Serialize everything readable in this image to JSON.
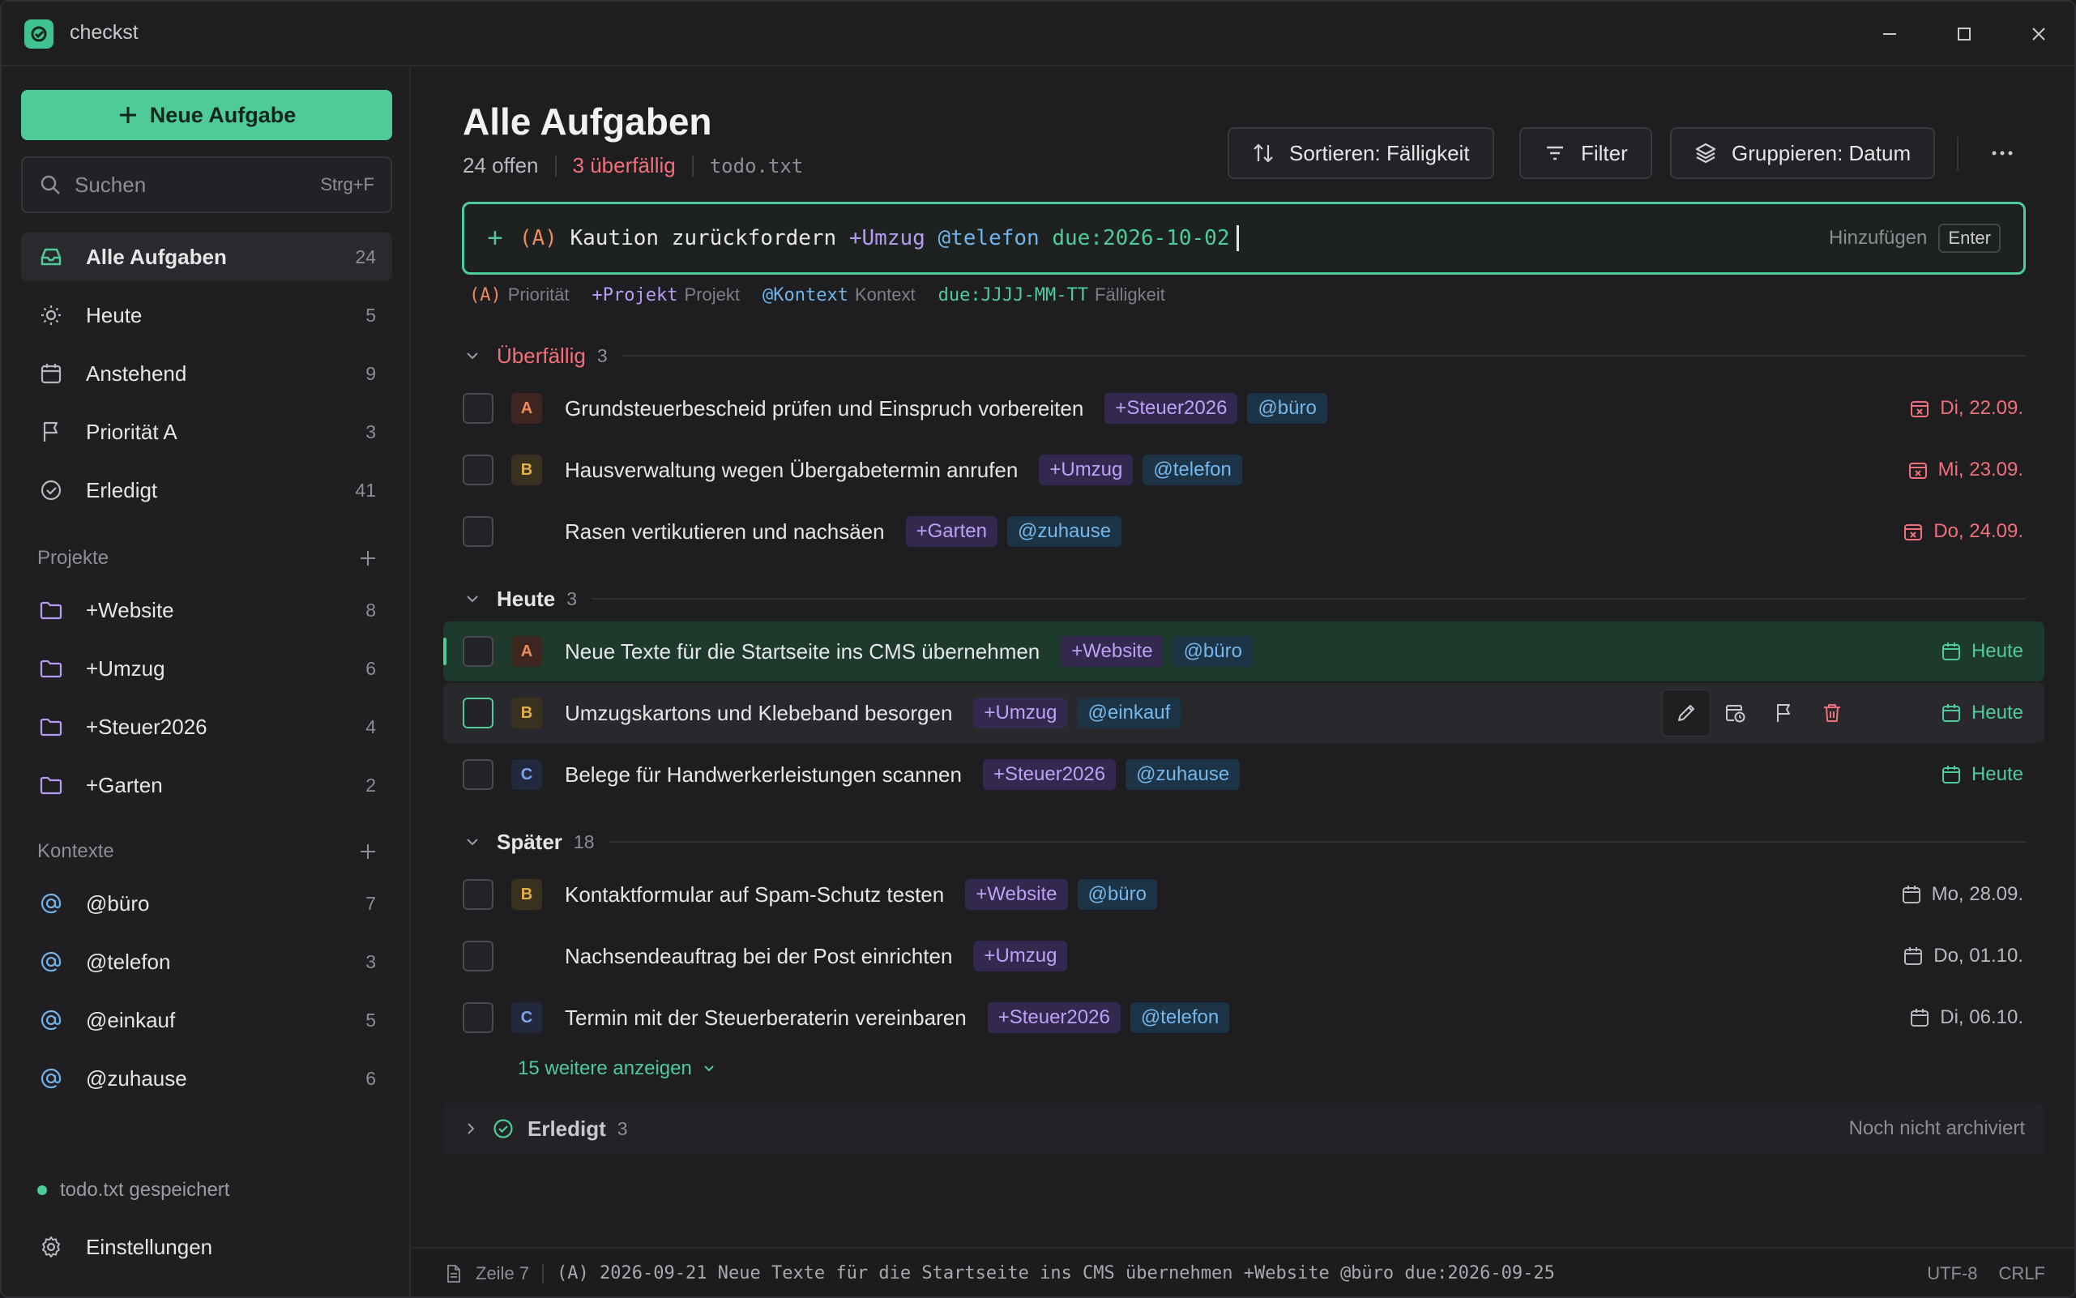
{
  "app": {
    "title": "checkst"
  },
  "sidebar": {
    "new_task_label": "Neue Aufgabe",
    "search_placeholder": "Suchen",
    "search_shortcut": "Strg+F",
    "views": [
      {
        "label": "Alle Aufgaben",
        "count": "24",
        "icon": "inbox-icon",
        "active": true
      },
      {
        "label": "Heute",
        "count": "5",
        "icon": "sun-icon"
      },
      {
        "label": "Anstehend",
        "count": "9",
        "icon": "calendar-icon"
      },
      {
        "label": "Priorität A",
        "count": "3",
        "icon": "flag-icon"
      },
      {
        "label": "Erledigt",
        "count": "41",
        "icon": "check-circle-icon"
      }
    ],
    "projects_heading": "Projekte",
    "projects": [
      {
        "label": "+Website",
        "count": "8"
      },
      {
        "label": "+Umzug",
        "count": "6"
      },
      {
        "label": "+Steuer2026",
        "count": "4"
      },
      {
        "label": "+Garten",
        "count": "2"
      }
    ],
    "contexts_heading": "Kontexte",
    "contexts": [
      {
        "label": "@büro",
        "count": "7"
      },
      {
        "label": "@telefon",
        "count": "3"
      },
      {
        "label": "@einkauf",
        "count": "5"
      },
      {
        "label": "@zuhause",
        "count": "6"
      }
    ],
    "saved_status": "todo.txt gespeichert",
    "settings_label": "Einstellungen"
  },
  "header": {
    "title": "Alle Aufgaben",
    "open_count": "24 offen",
    "overdue_count": "3 überfällig",
    "file": "todo.txt",
    "sort_label": "Sortieren: Fälligkeit",
    "filter_label": "Filter",
    "group_label": "Gruppieren: Datum"
  },
  "quickadd": {
    "prio": "(A)",
    "text": "Kaution zurückfordern",
    "project": "+Umzug",
    "context": "@telefon",
    "due": "due:2026-10-02",
    "hint": "Hinzufügen",
    "key": "Enter"
  },
  "legend": [
    {
      "key": "(A)",
      "desc": "Priorität",
      "kind": "prio"
    },
    {
      "key": "+Projekt",
      "desc": "Projekt",
      "kind": "proj"
    },
    {
      "key": "@Kontext",
      "desc": "Kontext",
      "kind": "ctx"
    },
    {
      "key": "due:JJJJ-MM-TT",
      "desc": "Fälligkeit",
      "kind": "due"
    }
  ],
  "groups": {
    "overdue": {
      "name": "Überfällig",
      "count": "3"
    },
    "today": {
      "name": "Heute",
      "count": "3"
    },
    "later": {
      "name": "Später",
      "count": "18"
    },
    "done": {
      "name": "Erledigt",
      "count": "3",
      "note": "Noch nicht archiviert"
    }
  },
  "tasks": [
    {
      "prio": "A",
      "text": "Grundsteuerbescheid prüfen und Einspruch vorbereiten",
      "project": "+Steuer2026",
      "context": "@büro",
      "due": "Di, 22.09.",
      "status": "over"
    },
    {
      "prio": "B",
      "text": "Hausverwaltung wegen Übergabetermin anrufen",
      "project": "+Umzug",
      "context": "@telefon",
      "due": "Mi, 23.09.",
      "status": "over"
    },
    {
      "prio": "",
      "text": "Rasen vertikutieren und nachsäen",
      "project": "+Garten",
      "context": "@zuhause",
      "due": "Do, 24.09.",
      "status": "over"
    },
    {
      "prio": "A",
      "text": "Neue Texte für die Startseite ins CMS übernehmen",
      "project": "+Website",
      "context": "@büro",
      "due": "Heute",
      "status": "today"
    },
    {
      "prio": "B",
      "text": "Umzugskartons und Klebeband besorgen",
      "project": "+Umzug",
      "context": "@einkauf",
      "due": "Heute",
      "status": "today"
    },
    {
      "prio": "C",
      "text": "Belege für Handwerkerleistungen scannen",
      "project": "+Steuer2026",
      "context": "@zuhause",
      "due": "Heute",
      "status": "today"
    },
    {
      "prio": "B",
      "text": "Kontaktformular auf Spam-Schutz testen",
      "project": "+Website",
      "context": "@büro",
      "due": "Mo, 28.09.",
      "status": "later"
    },
    {
      "prio": "",
      "text": "Nachsendeauftrag bei der Post einrichten",
      "project": "+Umzug",
      "context": "",
      "due": "Do, 01.10.",
      "status": "later"
    },
    {
      "prio": "C",
      "text": "Termin mit der Steuerberaterin vereinbaren",
      "project": "+Steuer2026",
      "context": "@telefon",
      "due": "Di, 06.10.",
      "status": "later"
    }
  ],
  "more_link": "15 weitere anzeigen",
  "statusbar": {
    "line": "Zeile 7",
    "raw": "(A) 2026-09-21 Neue Texte für die Startseite ins CMS übernehmen +Website @büro due:2026-09-25",
    "encoding": "UTF-8",
    "eol": "CRLF"
  },
  "colors": {
    "accent": "#4ecb98",
    "overdue": "#f0707a",
    "project": "#b79cf5",
    "context": "#6fb3e8",
    "priority": "#ef8a5c"
  }
}
